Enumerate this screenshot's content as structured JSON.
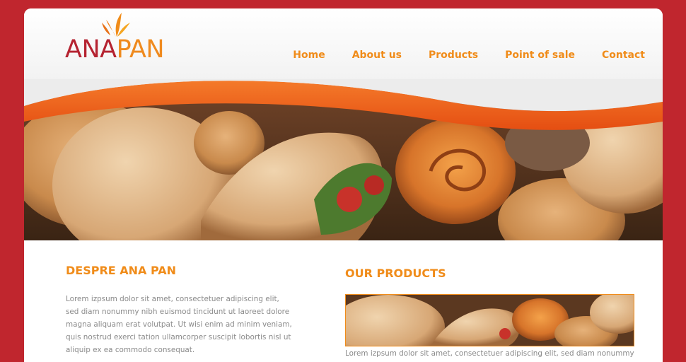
{
  "brand": {
    "part1": "ANA",
    "part2": "PAN"
  },
  "nav": {
    "items": [
      {
        "label": "Home"
      },
      {
        "label": "About us"
      },
      {
        "label": "Products"
      },
      {
        "label": "Point of sale"
      },
      {
        "label": "Contact"
      }
    ]
  },
  "about": {
    "title": "DESPRE ANA PAN",
    "text": "Lorem izpsum dolor sit amet, consectetuer adipiscing elit, sed diam nonummy nibh euismod tincidunt ut laoreet dolore magna aliquam erat volutpat. Ut wisi enim ad minim veniam, quis nostrud exerci tation ullamcorper suscipit lobortis nisl ut aliquip ex ea commodo consequat."
  },
  "products": {
    "title": "OUR PRODUCTS",
    "text": "Lorem izpsum dolor sit amet, consectetuer adipiscing elit, sed diam nonummy"
  },
  "colors": {
    "background": "#c0262e",
    "accent": "#f08c1a",
    "wave": "#f15a22",
    "brand_red": "#b52331"
  },
  "icons": {
    "logo": "flame-leaf-icon"
  }
}
